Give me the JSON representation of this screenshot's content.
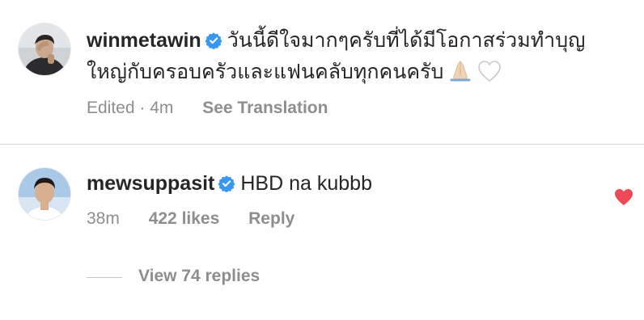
{
  "caption": {
    "username": "winmetawin",
    "verified": true,
    "text_line1": "วันนี้ดีใจมากๆครับที่ได้มีโอกาสร่วมทำบุญ",
    "text_line2": "ใหญ่กับครอบครัวและแฟนคลับทุกคนครับ",
    "emoji": [
      "folded-hands",
      "white-heart"
    ],
    "edited_time": "Edited · 4m",
    "see_translation": "See Translation"
  },
  "comment": {
    "username": "mewsuppasit",
    "verified": true,
    "text": "HBD na kubbb",
    "time": "38m",
    "likes": "422 likes",
    "reply": "Reply",
    "liked": true
  },
  "replies": {
    "label": "View 74 replies"
  },
  "colors": {
    "text": "#262626",
    "secondary": "#8e8e8e",
    "divider": "#dbdbdb",
    "verified": "#3897f0",
    "heart": "#ed4956"
  }
}
